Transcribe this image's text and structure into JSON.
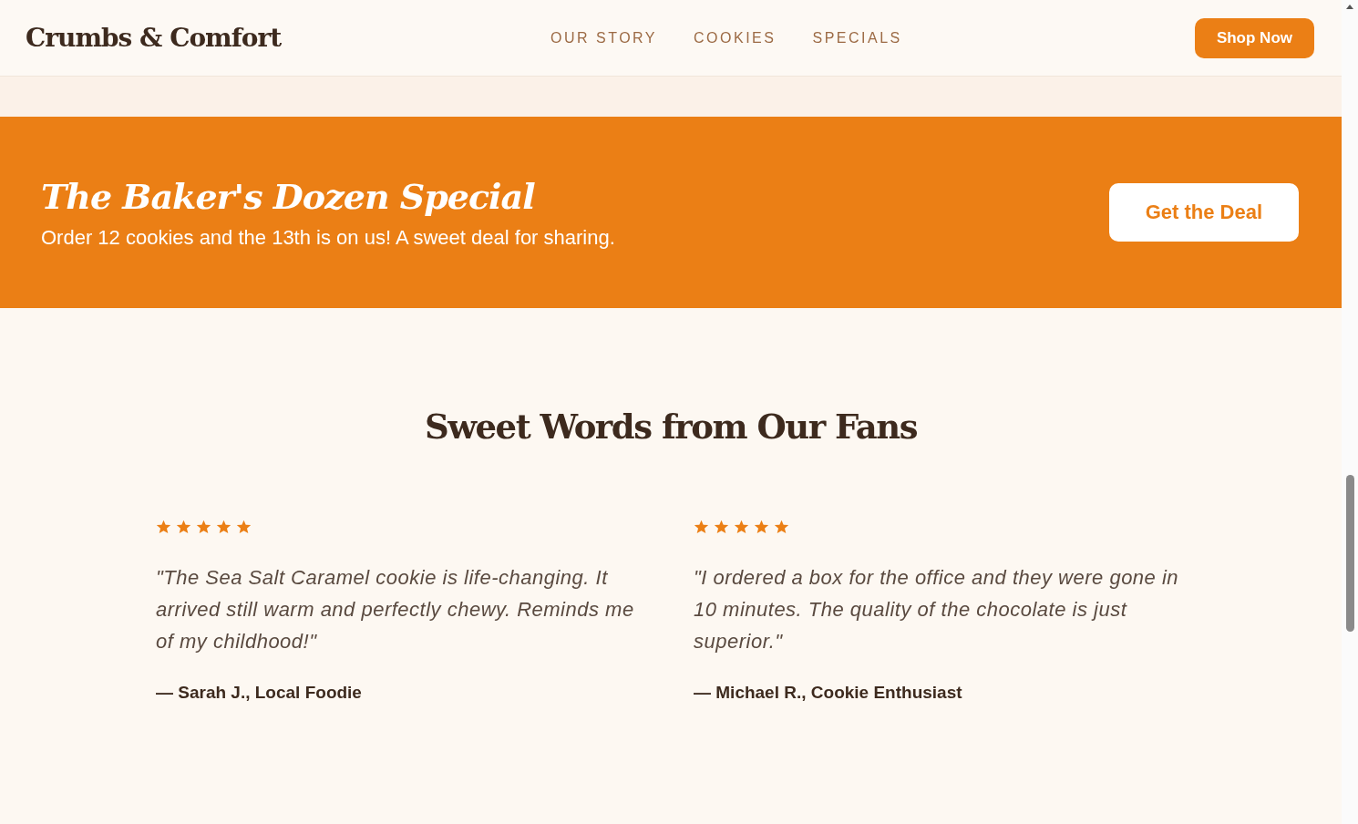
{
  "header": {
    "logo": "Crumbs & Comfort",
    "nav": [
      {
        "label": "OUR STORY"
      },
      {
        "label": "COOKIES"
      },
      {
        "label": "SPECIALS"
      }
    ],
    "cta": "Shop Now"
  },
  "promo": {
    "title": "The Baker's Dozen Special",
    "text": "Order 12 cookies and the 13th is on us! A sweet deal for sharing.",
    "button": "Get the Deal"
  },
  "testimonials": {
    "title": "Sweet Words from Our Fans",
    "items": [
      {
        "stars": 5,
        "quote": "\"The Sea Salt Caramel cookie is life-changing. It arrived still warm and perfectly chewy. Reminds me of my childhood!\"",
        "author": "— Sarah J., Local Foodie"
      },
      {
        "stars": 5,
        "quote": "\"I ordered a box for the office and they were gone in 10 minutes. The quality of the chocolate is just superior.\"",
        "author": "— Michael R., Cookie Enthusiast"
      }
    ]
  }
}
